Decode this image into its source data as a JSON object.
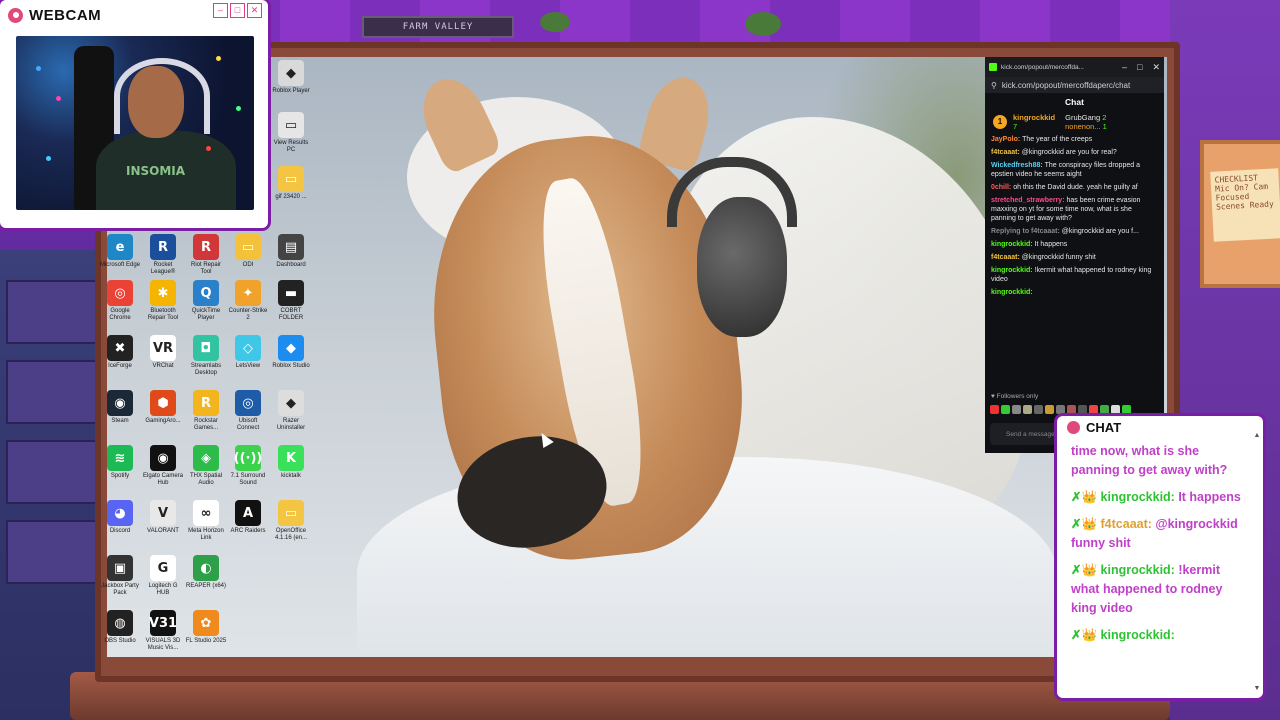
{
  "webcam": {
    "title": "WEBCAM",
    "shirt_text": "INSOMIA"
  },
  "room": {
    "plate_text": "FARM VALLEY",
    "sticky_note": "CHECKLIST Mic On? Cam Focused Scenes Ready"
  },
  "desktop": {
    "icons": [
      {
        "label": "gif 23420 ...",
        "icon": "folder-icon",
        "color": "#f4c542",
        "glyph": "▭"
      },
      {
        "label": "View Results PC",
        "icon": "file-icon",
        "color": "#e6e6e6",
        "glyph": "▭"
      },
      {
        "label": "Roblox Player",
        "icon": "roblox-icon",
        "color": "#d9d9d9",
        "glyph": "◆"
      },
      {
        "label": "Microsoft Edge",
        "icon": "edge-icon",
        "color": "#1e88c7",
        "glyph": "e"
      },
      {
        "label": "Rocket League®",
        "icon": "rocket-league-icon",
        "color": "#1b4e9b",
        "glyph": "R"
      },
      {
        "label": "Riot Repair Tool",
        "icon": "riot-icon",
        "color": "#d13639",
        "glyph": "R"
      },
      {
        "label": "ODI",
        "icon": "odi-icon",
        "color": "#f3c13a",
        "glyph": "▭"
      },
      {
        "label": "Dashboard",
        "icon": "dashboard-icon",
        "color": "#444",
        "glyph": "▤"
      },
      {
        "label": "Google Chrome",
        "icon": "chrome-icon",
        "color": "#ea4335",
        "glyph": "◎"
      },
      {
        "label": "Bluetooth Repair Tool",
        "icon": "bluetooth-icon",
        "color": "#f4b400",
        "glyph": "✱"
      },
      {
        "label": "QuickTime Player",
        "icon": "quicktime-icon",
        "color": "#2a80c9",
        "glyph": "Q"
      },
      {
        "label": "Counter-Strike 2",
        "icon": "cs2-icon",
        "color": "#f0a22b",
        "glyph": "✦"
      },
      {
        "label": "COBRT FOLDER",
        "icon": "folder-icon",
        "color": "#222",
        "glyph": "▬"
      },
      {
        "label": "IceForge",
        "icon": "iceforge-icon",
        "color": "#222",
        "glyph": "✖"
      },
      {
        "label": "VRChat",
        "icon": "vrchat-icon",
        "color": "#fff",
        "glyph": "VR"
      },
      {
        "label": "Streamlabs Desktop",
        "icon": "streamlabs-icon",
        "color": "#31c3a2",
        "glyph": "◘"
      },
      {
        "label": "LetsView",
        "icon": "letsview-icon",
        "color": "#3ec7e6",
        "glyph": "◇"
      },
      {
        "label": "Roblox Studio",
        "icon": "roblox-studio-icon",
        "color": "#1d8cf0",
        "glyph": "◆"
      },
      {
        "label": "Steam",
        "icon": "steam-icon",
        "color": "#1b2838",
        "glyph": "◉"
      },
      {
        "label": "GamingAro...",
        "icon": "gaming-icon",
        "color": "#e04a1a",
        "glyph": "⬢"
      },
      {
        "label": "Rockstar Games...",
        "icon": "rockstar-icon",
        "color": "#f3b51e",
        "glyph": "R"
      },
      {
        "label": "Ubisoft Connect",
        "icon": "ubisoft-icon",
        "color": "#1e5ca8",
        "glyph": "◎"
      },
      {
        "label": "Razer Uninstaller",
        "icon": "razer-icon",
        "color": "#ddd",
        "glyph": "◆"
      },
      {
        "label": "Spotify",
        "icon": "spotify-icon",
        "color": "#1db954",
        "glyph": "≋"
      },
      {
        "label": "Elgato Camera Hub",
        "icon": "elgato-icon",
        "color": "#111",
        "glyph": "◉"
      },
      {
        "label": "THX Spatial Audio",
        "icon": "thx-icon",
        "color": "#2dbb4a",
        "glyph": "◈"
      },
      {
        "label": "7.1 Surround Sound",
        "icon": "surround-icon",
        "color": "#3cd24e",
        "glyph": "((·))"
      },
      {
        "label": "kicktalk",
        "icon": "kicktalk-icon",
        "color": "#39e05a",
        "glyph": "K"
      },
      {
        "label": "Discord",
        "icon": "discord-icon",
        "color": "#5865f2",
        "glyph": "◕"
      },
      {
        "label": "VALORANT",
        "icon": "valorant-icon",
        "color": "#e8e8e8",
        "glyph": "V"
      },
      {
        "label": "Meta Horizon Link",
        "icon": "meta-icon",
        "color": "#fff",
        "glyph": "∞"
      },
      {
        "label": "ARC Raiders",
        "icon": "arc-raiders-icon",
        "color": "#111",
        "glyph": "A"
      },
      {
        "label": "OpenOffice 4.1.16 (en...",
        "icon": "folder-icon",
        "color": "#f4c542",
        "glyph": "▭"
      },
      {
        "label": "Jackbox Party Pack",
        "icon": "jackbox-icon",
        "color": "#333",
        "glyph": "▣"
      },
      {
        "label": "Logitech G HUB",
        "icon": "ghub-icon",
        "color": "#fff",
        "glyph": "G"
      },
      {
        "label": "REAPER (x64)",
        "icon": "reaper-icon",
        "color": "#2fa04a",
        "glyph": "◐"
      },
      {
        "label": "OBS Studio",
        "icon": "obs-icon",
        "color": "#222",
        "glyph": "◍"
      },
      {
        "label": "VISUALS 3D Music Vis...",
        "icon": "v31-icon",
        "color": "#111",
        "glyph": "V31"
      },
      {
        "label": "FL Studio 2025",
        "icon": "flstudio-icon",
        "color": "#f08a1c",
        "glyph": "✿"
      }
    ]
  },
  "kick_window": {
    "titlebar": "kick.com/popout/mercoffda...",
    "url": "kick.com/popout/mercoffdaperc/chat",
    "chat_header": "Chat",
    "leaders": [
      {
        "name": "kingrockkid",
        "count": "7"
      },
      {
        "name": "GrubGang",
        "count": "2"
      },
      {
        "name": "nonenon...",
        "count": "1"
      }
    ],
    "messages": [
      {
        "user": "JayPolo",
        "text": "The year of the creeps",
        "color": "#ff8a3a"
      },
      {
        "user": "f4tcaaat",
        "text": "@kingrockkid are you for real?",
        "color": "#f0c040"
      },
      {
        "user": "Wickedfresh88",
        "text": "The conspiracy files dropped a epstien video he seems aight",
        "color": "#57d1f2"
      },
      {
        "user": "0chill",
        "text": "oh this the David dude. yeah he guilty af",
        "color": "#ff5a5a"
      },
      {
        "user": "stretched_strawberry",
        "text": "has been crime evasion maxxing on yt for some time now, what is she panning to get away with?",
        "color": "#ff4a8a"
      },
      {
        "user": "Replying to f4tcaaat",
        "text": "@kingrockkid are you f...",
        "color": "#888888"
      },
      {
        "user": "kingrockkid",
        "text": "It happens",
        "color": "#53fc18"
      },
      {
        "user": "f4tcaaat",
        "text": "@kingrockkid funny shit",
        "color": "#f0c040"
      },
      {
        "user": "kingrockkid",
        "text": "!kermit what happened to rodney king video",
        "color": "#53fc18"
      },
      {
        "user": "kingrockkid",
        "text": "",
        "color": "#53fc18"
      }
    ],
    "followers_only": "Followers only",
    "input_placeholder": "Send a message"
  },
  "chat_overlay": {
    "title": "CHAT",
    "lines": [
      {
        "user": "",
        "text": "time now, what is she panning to get away with?"
      },
      {
        "user": "kingrockkid:",
        "text": "It happens"
      },
      {
        "user": "f4tcaaat:",
        "text": "@kingrockkid funny shit"
      },
      {
        "user": "kingrockkid:",
        "text": "!kermit what happened to rodney king video"
      },
      {
        "user": "kingrockkid:",
        "text": ""
      }
    ]
  }
}
